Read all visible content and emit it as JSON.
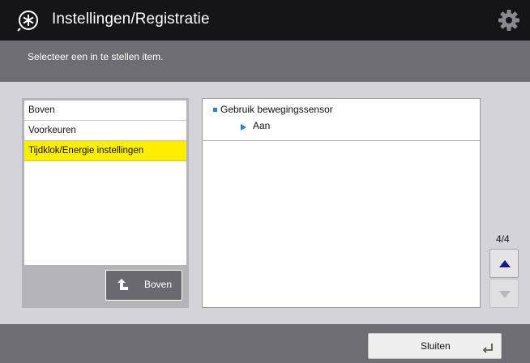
{
  "header": {
    "title": "Instellingen/Registratie",
    "logo_icon": "settings-registration-icon",
    "settings_icon": "gear-icon"
  },
  "subheader": {
    "instruction": "Selecteer een in te stellen item."
  },
  "menu": {
    "items": [
      {
        "label": "Boven",
        "selected": false
      },
      {
        "label": "Voorkeuren",
        "selected": false
      },
      {
        "label": "Tijdklok/Energie instellingen",
        "selected": true
      }
    ],
    "selected_color": "#ffee00",
    "up_button_label": "Boven",
    "up_button_icon": "up-level-arrow-icon"
  },
  "detail": {
    "setting_label": "Gebruik bewegingssensor",
    "setting_value": "Aan",
    "accent_color": "#2c7fd4"
  },
  "pager": {
    "text": "4/4"
  },
  "footer": {
    "close_label": "Sluiten",
    "close_icon": "enter-return-icon"
  }
}
